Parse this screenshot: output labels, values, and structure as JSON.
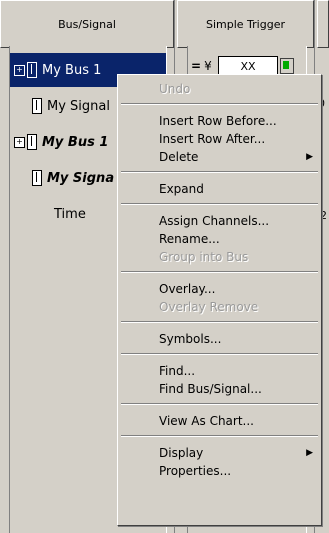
{
  "columns": {
    "left_header": "Bus/Signal",
    "mid_header": "Simple Trigger"
  },
  "rows": [
    {
      "label": "My Bus 1",
      "style": "normal",
      "expand": "+",
      "selected": true
    },
    {
      "label": "My Signal",
      "style": "normal",
      "expand": "",
      "selected": false
    },
    {
      "label": "My Bus 1",
      "style": "bold-italic",
      "expand": "+",
      "selected": false
    },
    {
      "label": "My Signa",
      "style": "bold-italic",
      "expand": "",
      "selected": false
    },
    {
      "label": "Time",
      "style": "normal",
      "expand": "",
      "selected": false
    }
  ],
  "trigger": {
    "eq": "=",
    "arrow": "¥",
    "value": "XX"
  },
  "right_ticks": [
    "0",
    "-2"
  ],
  "context_menu": {
    "items": [
      {
        "label": "Undo",
        "disabled": true
      },
      {
        "label": "Insert Row Before...",
        "disabled": false
      },
      {
        "label": "Insert Row After...",
        "disabled": false
      },
      {
        "label": "Delete",
        "disabled": false,
        "submenu": true
      },
      {
        "label": "Expand",
        "disabled": false
      },
      {
        "label": "Assign Channels...",
        "disabled": false
      },
      {
        "label": "Rename...",
        "disabled": false
      },
      {
        "label": "Group into Bus",
        "disabled": true
      },
      {
        "label": "Overlay...",
        "disabled": false
      },
      {
        "label": "Overlay Remove",
        "disabled": true
      },
      {
        "label": "Symbols...",
        "disabled": false
      },
      {
        "label": "Find...",
        "disabled": false
      },
      {
        "label": "Find Bus/Signal...",
        "disabled": false
      },
      {
        "label": "View As Chart...",
        "disabled": false
      },
      {
        "label": "Display",
        "disabled": false,
        "submenu": true
      },
      {
        "label": "Properties...",
        "disabled": false
      }
    ],
    "submenu_arrow": "▶"
  }
}
